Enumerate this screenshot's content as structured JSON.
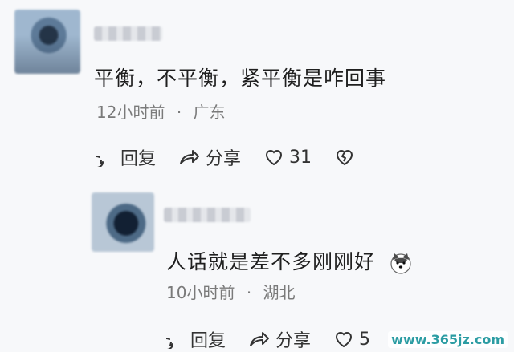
{
  "comments": {
    "main": {
      "text": "平衡，不平衡，紧平衡是咋回事",
      "time": "12小时前",
      "location": "广东",
      "actions": {
        "reply": "回复",
        "share": "分享",
        "likes": "31"
      }
    },
    "reply": {
      "text": "人话就是差不多刚刚好",
      "time": "10小时前",
      "location": "湖北",
      "actions": {
        "reply": "回复",
        "share": "分享",
        "likes": "5"
      }
    }
  },
  "watermark": "www.365jz.com",
  "separator": "·",
  "colors": {
    "background": "#f7f8fa",
    "text": "#1f1f1f",
    "meta": "#7a7a7a"
  }
}
